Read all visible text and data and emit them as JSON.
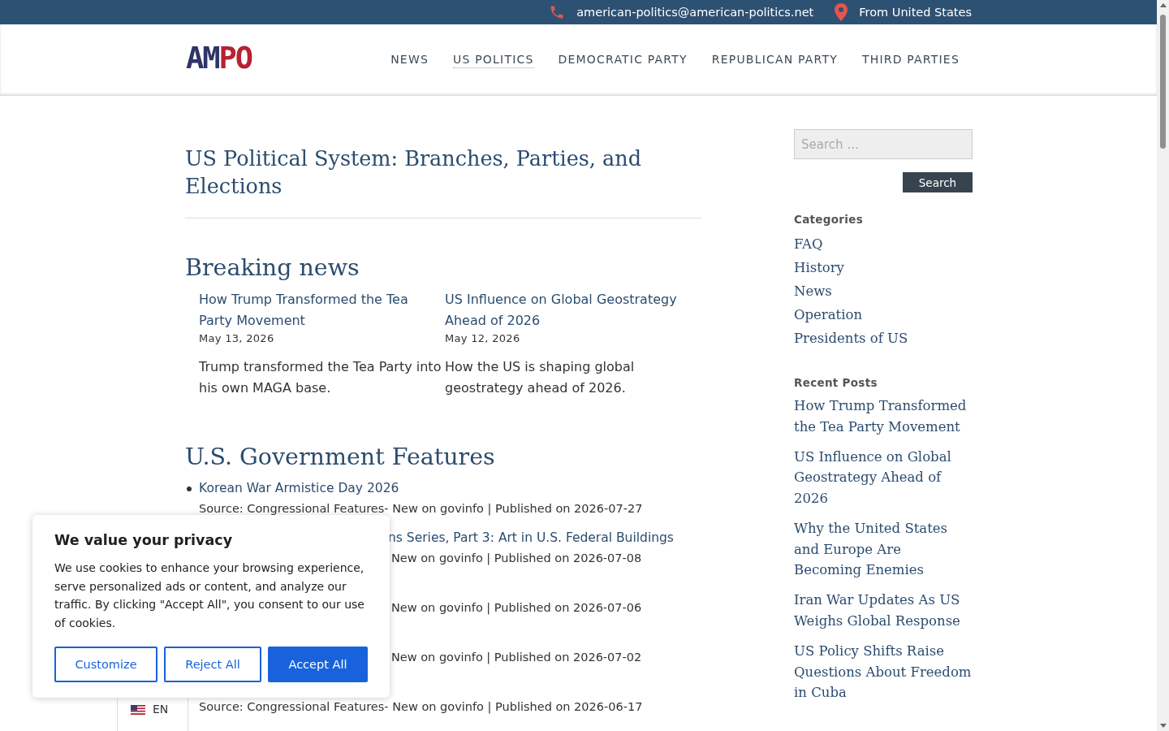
{
  "top_bar": {
    "email": "american-politics@american-politics.net",
    "location": "From United States"
  },
  "header": {
    "logo": [
      {
        "text": "AM",
        "color": "#2f3567"
      },
      {
        "text": "PO",
        "color": "#b5222f"
      }
    ],
    "nav": [
      {
        "label": "NEWS",
        "selected": false
      },
      {
        "label": "US POLITICS",
        "selected": true
      },
      {
        "label": "DEMOCRATIC PARTY",
        "selected": false
      },
      {
        "label": "REPUBLICAN PARTY",
        "selected": false
      },
      {
        "label": "THIRD PARTIES",
        "selected": false
      }
    ]
  },
  "page_title": "US Political System: Branches, Parties, and Elections",
  "breaking_news": {
    "heading": "Breaking news",
    "posts": [
      {
        "title": "How Trump Transformed the Tea Party Movement",
        "date": "May 13, 2026",
        "excerpt": "Trump transformed the Tea Party into his own MAGA base."
      },
      {
        "title": "US Influence on Global Geostrategy Ahead of 2026",
        "date": "May 12, 2026",
        "excerpt": "How the US is shaping global geostrategy ahead of 2026."
      }
    ]
  },
  "features": {
    "heading": "U.S. Government Features",
    "items": [
      {
        "title": "Korean War Armistice Day 2026",
        "source": "Source: Congressional Features- New on govinfo | Published on 2026-07-27",
        "covered": false
      },
      {
        "title": "ns Series, Part 3: Art in U.S. Federal Buildings",
        "source": "New on govinfo | Published on 2026-07-08",
        "covered": true
      },
      {
        "source": "New on govinfo | Published on 2026-07-06",
        "covered": true
      },
      {
        "source": "New on govinfo | Published on 2026-07-02",
        "covered": true
      },
      {
        "source": "Source: Congressional Features- New on govinfo | Published on 2026-06-17",
        "covered": false
      }
    ]
  },
  "sidebar": {
    "search": {
      "placeholder": "Search …",
      "button": "Search"
    },
    "categories": {
      "heading": "Categories",
      "items": [
        "FAQ",
        "History",
        "News",
        "Operation",
        "Presidents of US"
      ]
    },
    "recent_posts": {
      "heading": "Recent Posts",
      "items": [
        "How Trump Transformed the Tea Party Movement",
        "US Influence on Global Geostrategy Ahead of 2026",
        "Why the United States and Europe Are Becoming Enemies",
        "Iran War Updates As US Weighs Global Response",
        "US Policy Shifts Raise Questions About Freedom in Cuba"
      ]
    }
  },
  "cookie_banner": {
    "title": "We value your privacy",
    "text": "We use cookies to enhance your browsing experience, serve personalized ads or content, and analyze our traffic. By clicking \"Accept All\", you consent to our use of cookies.",
    "buttons": [
      {
        "label": "Customize",
        "kind": "outline"
      },
      {
        "label": "Reject All",
        "kind": "outline"
      },
      {
        "label": "Accept All",
        "kind": "primary"
      }
    ]
  },
  "language": {
    "code": "EN"
  }
}
